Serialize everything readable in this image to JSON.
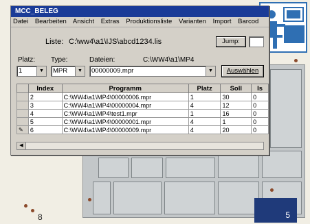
{
  "window": {
    "title": "MCC_BELEG"
  },
  "menu": [
    "Datei",
    "Bearbeiten",
    "Ansicht",
    "Extras",
    "Produktionsliste",
    "Varianten",
    "Import",
    "Barcod"
  ],
  "list": {
    "label": "Liste:",
    "path": "C:\\ww4\\a1\\IJS\\abcd1234.lis",
    "jump_label": "Jump:"
  },
  "controls": {
    "platz_label": "Platz:",
    "platz_value": "1",
    "typ_label": "Type:",
    "typ_value": "MPR",
    "dateien_label": "Dateien:",
    "dateien_path": "C:\\WW4\\a1\\MP4",
    "dateien_value": "00000009.mpr",
    "auswaehlen_label": "Auswählen"
  },
  "table": {
    "headers": [
      "Index",
      "Programm",
      "Platz",
      "Soll",
      "Is"
    ],
    "rows": [
      {
        "marker": "",
        "index": "2",
        "programm": "C:\\WW4\\a1\\MP4\\00000006.mpr",
        "platz": "1",
        "soll": "30",
        "ist": "0"
      },
      {
        "marker": "",
        "index": "3",
        "programm": "C:\\WW4\\a1\\MP4\\00000004.mpr",
        "platz": "4",
        "soll": "12",
        "ist": "0"
      },
      {
        "marker": "",
        "index": "4",
        "programm": "C:\\WW4\\a1\\MP4\\test1.mpr",
        "platz": "1",
        "soll": "16",
        "ist": "0"
      },
      {
        "marker": "",
        "index": "5",
        "programm": "C:\\WW4\\a1\\MP4\\00000001.mpr",
        "platz": "4",
        "soll": "1",
        "ist": "0"
      },
      {
        "marker": "✎",
        "index": "6",
        "programm": "C:\\WW4\\a1\\MP4\\00000009.mpr",
        "platz": "4",
        "soll": "20",
        "ist": "0"
      }
    ]
  },
  "footer": {
    "left_number": "8",
    "right_number": "5"
  }
}
